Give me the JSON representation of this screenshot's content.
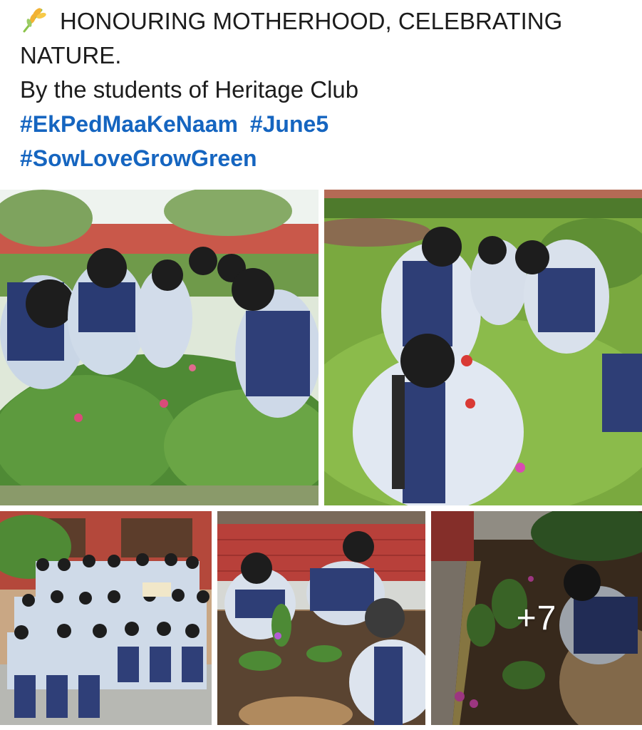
{
  "post": {
    "title_line1": "HONOURING MOTHERHOOD, CELEBRATING",
    "title_line2": "NATURE.",
    "byline": "By the students of Heritage Club",
    "hashtags_row1": [
      "#EkPedMaaKeNaam",
      "#June5"
    ],
    "hashtags_row2": [
      "#SowLoveGrowGreen"
    ],
    "emoji_icon": "wheat-sprout-icon",
    "hashtag_color": "#1565c0"
  },
  "gallery": {
    "photos": [
      {
        "icon": "photo-students-planting-shrubs"
      },
      {
        "icon": "photo-students-planting-lawn"
      },
      {
        "icon": "photo-group-holding-saplings"
      },
      {
        "icon": "photo-students-planting-bed"
      },
      {
        "icon": "photo-student-planting-border"
      }
    ],
    "more_count": "+7"
  }
}
